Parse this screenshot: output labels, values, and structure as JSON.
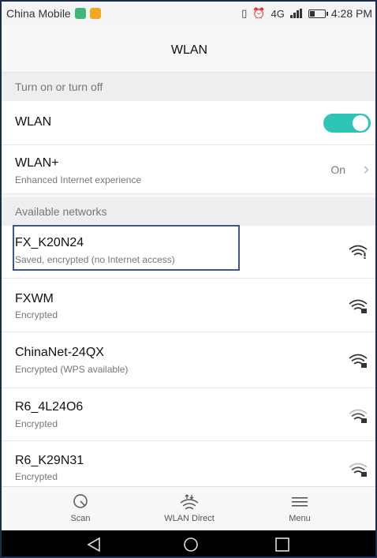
{
  "status_bar": {
    "carrier": "China Mobile",
    "network": "4G",
    "time": "4:28 PM",
    "battery_level": 0.35
  },
  "header": {
    "title": "WLAN"
  },
  "sections": {
    "toggle_header": "Turn on or turn off",
    "networks_header": "Available networks"
  },
  "wlan": {
    "label": "WLAN",
    "enabled": true
  },
  "wlan_plus": {
    "label": "WLAN+",
    "sub": "Enhanced Internet experience",
    "value": "On"
  },
  "networks": [
    {
      "name": "FX_K20N24",
      "status": "Saved, encrypted (no Internet access)",
      "signal": 3,
      "highlighted": true
    },
    {
      "name": "FXWM",
      "status": "Encrypted",
      "signal": 3
    },
    {
      "name": "ChinaNet-24QX",
      "status": "Encrypted (WPS available)",
      "signal": 3
    },
    {
      "name": "R6_4L24O6",
      "status": "Encrypted",
      "signal": 2
    },
    {
      "name": "R6_K29N31",
      "status": "Encrypted",
      "signal": 2
    }
  ],
  "bottom_bar": {
    "scan": "Scan",
    "wlan_direct": "WLAN Direct",
    "menu": "Menu"
  },
  "colors": {
    "accent": "#2ec4b6",
    "highlight_border": "#3a5a8a"
  }
}
